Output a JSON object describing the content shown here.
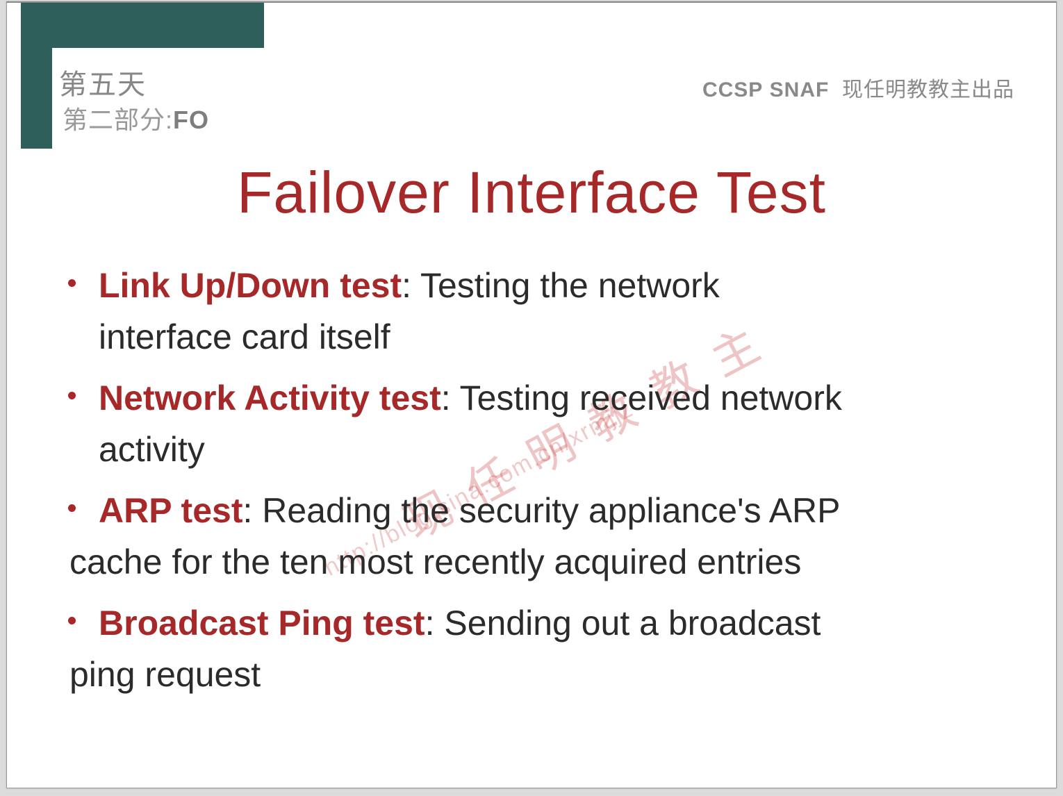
{
  "header": {
    "day_label": "第五天",
    "section_prefix": "第二部分:",
    "section_code": "FO",
    "brand_ccsp": "CCSP",
    "brand_snaf": "SNAF",
    "brand_suffix": "现任明教教主出品"
  },
  "title": "Failover Interface Test",
  "bullets": [
    {
      "bold": "Link Up/Down test",
      "rest_line1": ": Testing the network",
      "cont": "interface card itself"
    },
    {
      "bold": "Network Activity test",
      "rest_line1": ": Testing received network",
      "cont": "activity"
    },
    {
      "bold": "ARP test",
      "rest_line1": ": Reading the security appliance's ARP",
      "hang": "cache for the ten most recently acquired entries"
    },
    {
      "bold": "Broadcast Ping test",
      "rest_line1": ": Sending out a broadcast",
      "hang": "ping request"
    }
  ],
  "watermark": {
    "main": "现任明教教主",
    "url": "http://blog.sina.com.cn/xrmjjz"
  }
}
